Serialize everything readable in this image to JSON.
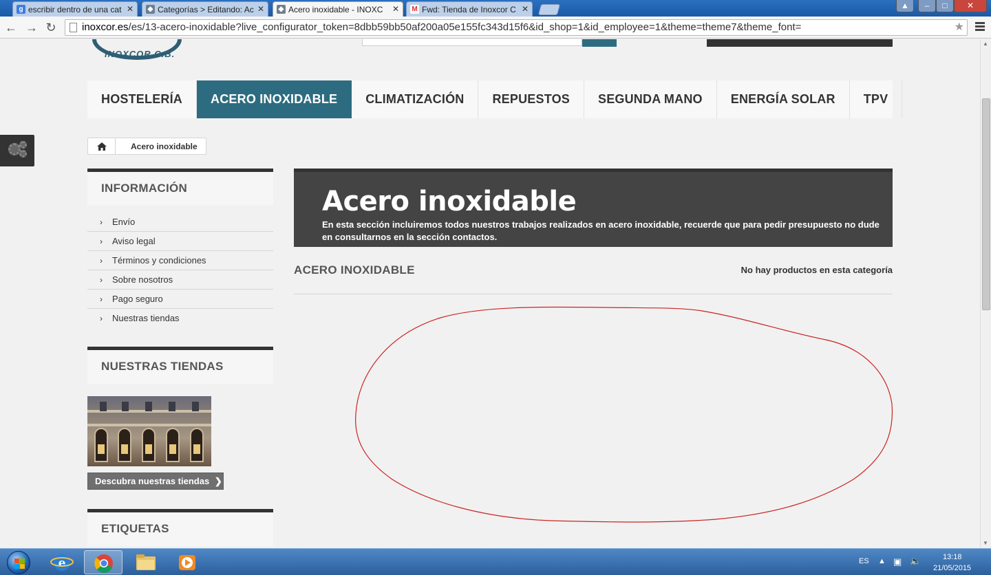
{
  "browser": {
    "tabs": [
      {
        "label": "escribir dentro de una cat",
        "favicon": "google-icon",
        "active": false
      },
      {
        "label": "Categorías > Editando: Ac",
        "favicon": "prestashop-icon",
        "active": false
      },
      {
        "label": "Acero inoxidable - INOXC",
        "favicon": "prestashop-icon",
        "active": true
      },
      {
        "label": "Fwd: Tienda de Inoxcor C",
        "favicon": "gmail-icon",
        "active": false
      }
    ],
    "url_host": "inoxcor.es",
    "url_path": "/es/13-acero-inoxidable?live_configurator_token=8dbb59bb50af200a05e155fc343d15f6&id_shop=1&id_employee=1&theme=theme7&theme_font=",
    "controls": {
      "minimize": "–",
      "maximize": "□",
      "close": "✕"
    }
  },
  "site": {
    "logo_text": "INOXCOR C.B.",
    "nav": [
      {
        "label": "HOSTELERÍA",
        "active": false
      },
      {
        "label": "ACERO INOXIDABLE",
        "active": true
      },
      {
        "label": "CLIMATIZACIÓN",
        "active": false
      },
      {
        "label": "REPUESTOS",
        "active": false
      },
      {
        "label": "SEGUNDA MANO",
        "active": false
      },
      {
        "label": "ENERGÍA SOLAR",
        "active": false
      },
      {
        "label": "TPV",
        "active": false
      }
    ],
    "breadcrumb": {
      "home_icon": "home-icon",
      "current": "Acero inoxidable"
    },
    "sidebar": {
      "info_title": "INFORMACIÓN",
      "info_items": [
        "Envío",
        "Aviso legal",
        "Términos y condiciones",
        "Sobre nosotros",
        "Pago seguro",
        "Nuestras tiendas"
      ],
      "stores_title": "NUESTRAS TIENDAS",
      "stores_button": "Descubra nuestras tiendas",
      "tags_title": "ETIQUETAS"
    },
    "category": {
      "title": "Acero inoxidable",
      "description": "En esta sección incluiremos todos nuestros trabajos realizados en acero inoxidable, recuerde que para pedir presupuesto no dude en consultarnos en la sección contactos.",
      "heading": "ACERO INOXIDABLE",
      "empty_message": "No hay productos en esta categoría"
    },
    "colors": {
      "accent": "#2d6c80",
      "dark": "#444444",
      "annotation": "#cc2222"
    }
  },
  "taskbar": {
    "apps": [
      "start-orb",
      "internet-explorer-icon",
      "chrome-icon",
      "file-explorer-icon",
      "media-player-icon"
    ],
    "language": "ES",
    "time": "13:18",
    "date": "21/05/2015"
  }
}
